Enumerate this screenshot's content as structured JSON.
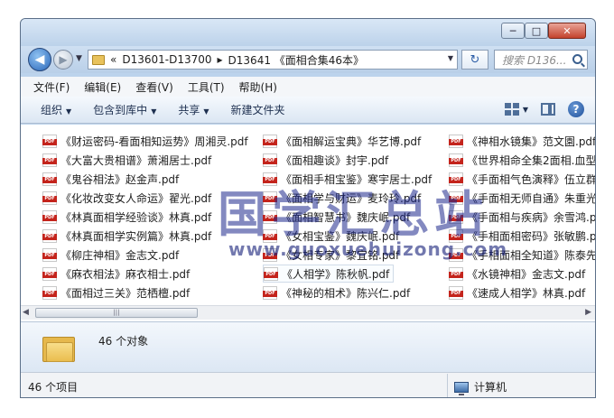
{
  "window": {
    "controls": {
      "minimize": "─",
      "maximize": "□",
      "close": "✕"
    }
  },
  "nav": {
    "back": "◀",
    "forward": "▶",
    "breadcrumb": [
      "«",
      "D13601-D13700",
      "▸",
      "D13641 《面相合集46本》"
    ],
    "refresh": "↻",
    "search_placeholder": "搜索 D136..."
  },
  "menu": [
    "文件(F)",
    "编辑(E)",
    "查看(V)",
    "工具(T)",
    "帮助(H)"
  ],
  "toolbar": {
    "organize": "组织",
    "include_library": "包含到库中",
    "share": "共享",
    "new_folder": "新建文件夹",
    "help": "?"
  },
  "files": [
    [
      "《财运密码-看面相知运势》周湘灵.pdf",
      "《大富大贵相谱》萧湘居士.pdf",
      "《鬼谷相法》赵金声.pdf",
      "《化妆改变女人命运》翟光.pdf",
      "《林真面相学经验谈》林真.pdf",
      "《林真面相学实例篇》林真.pdf",
      "《柳庄神相》金志文.pdf",
      "《麻衣相法》麻衣相士.pdf",
      "《面相过三关》范栖檀.pdf"
    ],
    [
      "《面相解运宝典》华艺博.pdf",
      "《面相趣谈》封宇.pdf",
      "《面相手相宝鉴》寒宇居士.pdf",
      "《面相学与财运》麦玲玲.pdf",
      "《面相智慧书》魏庆岷.pdf",
      "《女相宝鉴》魏庆岷.pdf",
      "《女相专家》黎宜铭.pdf",
      "《人相学》陈秋帆.pdf",
      "《神秘的相术》陈兴仁.pdf"
    ],
    [
      "《神相水镜集》范文園.pdf",
      "《世界相命全集2面相.血型》",
      "《手面相气色演释》伍立群",
      "《手面相无师自通》朱重光",
      "《手面相与疾病》余雪鸿.pdf",
      "《手相面相密码》张敏鹏.pdf",
      "《手相面相全知道》陈泰先",
      "《水镜神相》金志文.pdf",
      "《速成人相学》林真.pdf"
    ]
  ],
  "watermark": {
    "title": "国学汇总站",
    "url": "www.guoxuehuizong.com"
  },
  "scrollbar": {
    "left": "◀",
    "right": "▶",
    "grip": "|||"
  },
  "details": {
    "count": "46 个对象"
  },
  "status": {
    "items": "46 个项目",
    "location": "计算机"
  }
}
